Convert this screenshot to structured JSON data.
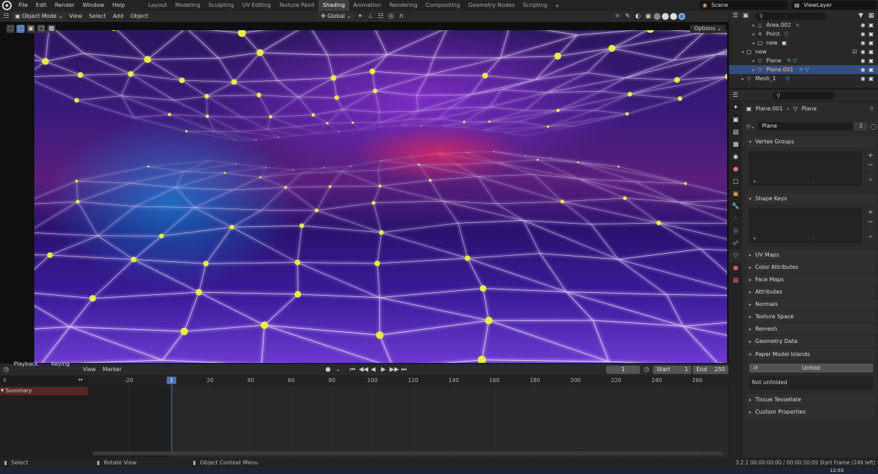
{
  "topbar": {
    "menus": [
      "File",
      "Edit",
      "Render",
      "Window",
      "Help"
    ],
    "workspaces": [
      "Layout",
      "Modeling",
      "Sculpting",
      "UV Editing",
      "Texture Paint",
      "Shading",
      "Animation",
      "Rendering",
      "Compositing",
      "Geometry Nodes",
      "Scripting"
    ],
    "active_workspace": "Shading",
    "add_workspace": "+",
    "scene": "Scene",
    "view_layer": "ViewLayer"
  },
  "viewport": {
    "mode": "Object Mode",
    "menus": [
      "View",
      "Select",
      "Add",
      "Object"
    ],
    "orientation": "Global",
    "options": "Options"
  },
  "timeline": {
    "menus": [
      "Playback",
      "Keying",
      "View",
      "Marker"
    ],
    "current_frame": "1",
    "start_label": "Start",
    "start": "1",
    "end_label": "End",
    "end": "250",
    "ruler_ticks": [
      "-20",
      "20",
      "40",
      "60",
      "80",
      "100",
      "120",
      "140",
      "160",
      "180",
      "200",
      "220",
      "240",
      "260"
    ],
    "playhead_label": "1",
    "summary": "Summary"
  },
  "outliner": {
    "rows": [
      {
        "name": "Area.002",
        "icon": "light-icon"
      },
      {
        "name": "Point",
        "icon": "light-icon"
      },
      {
        "name": "new",
        "icon": "collection-icon"
      },
      {
        "name": "new",
        "icon": "collection-icon"
      },
      {
        "name": "Plane",
        "icon": "mesh-icon"
      },
      {
        "name": "Plane.001",
        "icon": "mesh-icon",
        "selected": true
      },
      {
        "name": "Mesh_1",
        "icon": "mesh-icon"
      }
    ]
  },
  "properties": {
    "breadcrumb_object": "Plane.001",
    "breadcrumb_data": "Plane",
    "mesh_name": "Plane",
    "mesh_users": "2",
    "panels": {
      "vertex_groups": "Vertex Groups",
      "shape_keys": "Shape Keys",
      "uv_maps": "UV Maps",
      "color_attributes": "Color Attributes",
      "face_maps": "Face Maps",
      "attributes": "Attributes",
      "normals": "Normals",
      "texture_space": "Texture Space",
      "remesh": "Remesh",
      "geometry_data": "Geometry Data",
      "paper_model": "Paper Model Islands",
      "tissue": "Tissue Tessellate",
      "custom_props": "Custom Properties"
    },
    "unfold_button": "Unfold",
    "unfold_status": "Not unfolded"
  },
  "statusbar": {
    "select": "Select",
    "rotate": "Rotate View",
    "context": "Object Context Menu",
    "version_info": "3.2.2  00:00:00:00 / 00:00:10:09  Start Frame (249 left)"
  },
  "taskbar": {
    "clock": "12:03"
  }
}
